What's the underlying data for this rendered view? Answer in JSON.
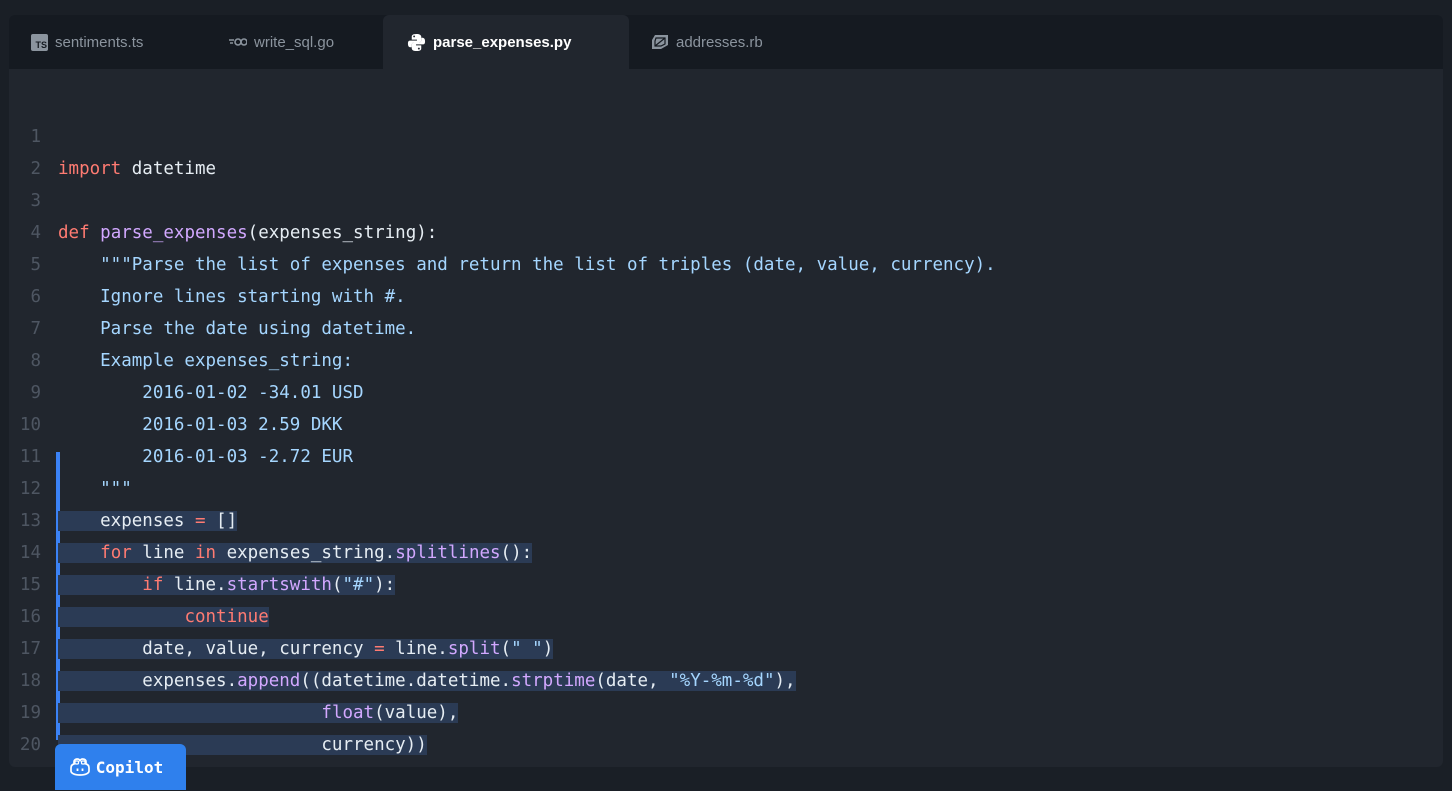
{
  "tabs": [
    {
      "label": "sentiments.ts",
      "icon": "typescript-icon",
      "icon_text": "TS",
      "active": false
    },
    {
      "label": "write_sql.go",
      "icon": "go-icon",
      "active": false
    },
    {
      "label": "parse_expenses.py",
      "icon": "python-icon",
      "active": true
    },
    {
      "label": "addresses.rb",
      "icon": "ruby-icon",
      "active": false
    }
  ],
  "editor": {
    "line_numbers": [
      "1",
      "2",
      "3",
      "4",
      "5",
      "6",
      "7",
      "8",
      "9",
      "10",
      "11",
      "12",
      "13",
      "14",
      "15",
      "16",
      "17",
      "18",
      "19",
      "20"
    ],
    "highlighted_lines": [
      12,
      20
    ]
  },
  "copilot": {
    "label": "Copilot"
  },
  "colors": {
    "background": "#21262e",
    "tabbar": "#151a21",
    "keyword": "#ff7b72",
    "function": "#d2a8ff",
    "string": "#a5d6ff",
    "selection": "#2b3b55",
    "accent": "#2f80ed"
  }
}
